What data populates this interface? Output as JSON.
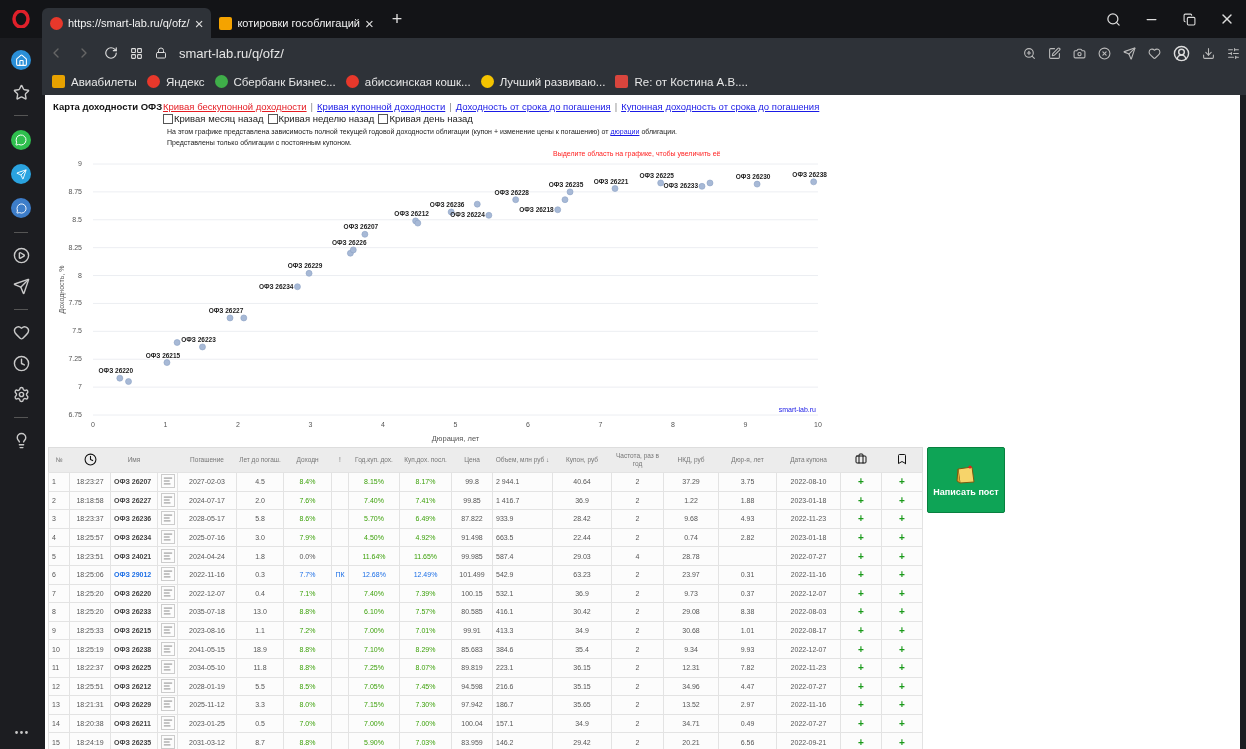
{
  "browser": {
    "tabs": [
      {
        "title": "https://smart-lab.ru/q/ofz/",
        "selected": true,
        "close": "×"
      },
      {
        "title": "котировки гособлигаций",
        "selected": false,
        "close": "×"
      }
    ],
    "new_tab": "+",
    "address": "smart-lab.ru/q/ofz/",
    "bookmarks": [
      {
        "label": "Авиабилеты",
        "color": "#e8a200"
      },
      {
        "label": "Яндекс",
        "color": "#e8382b"
      },
      {
        "label": "Сбербанк Бизнес...",
        "color": "#3fae49"
      },
      {
        "label": "абиссинская кошк...",
        "color": "#e8382b"
      },
      {
        "label": "Лучший развиваю...",
        "color": "#f5c400"
      },
      {
        "label": "Re: от Костина А.В....",
        "color": "#d9453d"
      }
    ]
  },
  "page": {
    "title": "Карта доходности ОФЗ",
    "links": [
      {
        "label": "Кривая бескупонной доходности",
        "selected": true
      },
      {
        "label": "Кривая купонной доходности",
        "selected": false
      },
      {
        "label": "Доходность от срока до погашения",
        "selected": false
      },
      {
        "label": "Купонная доходность от срока до погашения",
        "selected": false
      }
    ],
    "separator": "|",
    "checkboxes": [
      {
        "label": "Кривая месяц назад",
        "checked": false
      },
      {
        "label": "Кривая неделю назад",
        "checked": false
      },
      {
        "label": "Кривая день назад",
        "checked": false
      }
    ],
    "description": [
      {
        "kind": "text",
        "text": "На этом графике представлена зависимость полной текущей годовой доходности облигации (купон + изменение цены к погашению) от "
      },
      {
        "kind": "link",
        "text": "дюрации"
      },
      {
        "kind": "text",
        "text": " облигации."
      }
    ],
    "description_2": "Представлены только облигации с постоянным купоном.",
    "hint": "Выделите область на графике, чтобы увеличить её",
    "credit": "smart-lab.ru",
    "chart_data": {
      "type": "scatter",
      "grid": true,
      "xlabel": "Дюрация, лет",
      "ylabel": "Доходность, %",
      "xlim": [
        0,
        10
      ],
      "ylim": [
        6.75,
        9
      ],
      "xticks": [
        0,
        1,
        2,
        3,
        4,
        5,
        6,
        7,
        8,
        9,
        10
      ],
      "yticks": [
        {
          "value": 6.75,
          "label": "6.75"
        },
        {
          "value": 7,
          "label": "7"
        },
        {
          "value": 7.25,
          "label": "7.25"
        },
        {
          "value": 7.5,
          "label": "7.5"
        },
        {
          "value": 7.75,
          "label": "7.75"
        },
        {
          "value": 8,
          "label": "8"
        },
        {
          "value": 8.25,
          "label": "8.25"
        },
        {
          "value": 8.5,
          "label": "8.5"
        },
        {
          "value": 8.75,
          "label": "8.75"
        },
        {
          "value": 9,
          "label": "9"
        }
      ],
      "x": [
        0.37,
        0.49,
        1.02,
        1.16,
        1.51,
        1.89,
        2.08,
        2.82,
        2.98,
        3.55,
        3.59,
        3.75,
        4.45,
        4.48,
        4.94,
        5.3,
        5.46,
        5.83,
        6.41,
        6.51,
        6.58,
        7.2,
        7.83,
        8.4,
        8.51,
        9.16,
        9.94
      ],
      "series": [
        {
          "color": "#a7b9d6",
          "values": [
            7.08,
            7.05,
            7.22,
            7.4,
            7.36,
            7.62,
            7.62,
            7.9,
            8.02,
            8.2,
            8.23,
            8.37,
            8.49,
            8.47,
            8.57,
            8.64,
            8.54,
            8.68,
            8.59,
            8.68,
            8.75,
            8.78,
            8.83,
            8.8,
            8.83,
            8.82,
            8.84
          ]
        }
      ],
      "annotations": [
        {
          "x": 0.37,
          "y": 7.08,
          "text": "ОФЗ 26220"
        },
        {
          "x": 1.02,
          "y": 7.22,
          "text": "ОФЗ 26215"
        },
        {
          "x": 1.51,
          "y": 7.36,
          "text": "ОФЗ 26223"
        },
        {
          "x": 1.89,
          "y": 7.62,
          "text": "ОФЗ 26227"
        },
        {
          "x": 2.82,
          "y": 7.9,
          "text": "ОФЗ 26234"
        },
        {
          "x": 2.98,
          "y": 8.02,
          "text": "ОФЗ 26229"
        },
        {
          "x": 3.59,
          "y": 8.23,
          "text": "ОФЗ 26226"
        },
        {
          "x": 3.75,
          "y": 8.37,
          "text": "ОФЗ 26207"
        },
        {
          "x": 4.45,
          "y": 8.49,
          "text": "ОФЗ 26212"
        },
        {
          "x": 4.94,
          "y": 8.57,
          "text": "ОФЗ 26236"
        },
        {
          "x": 5.46,
          "y": 8.54,
          "text": "ОФЗ 26224"
        },
        {
          "x": 5.83,
          "y": 8.68,
          "text": "ОФЗ 26228"
        },
        {
          "x": 6.41,
          "y": 8.59,
          "text": "ОФЗ 26218"
        },
        {
          "x": 6.58,
          "y": 8.75,
          "text": "ОФЗ 26235"
        },
        {
          "x": 7.2,
          "y": 8.78,
          "text": "ОФЗ 26221"
        },
        {
          "x": 7.83,
          "y": 8.83,
          "text": "ОФЗ 26225"
        },
        {
          "x": 8.4,
          "y": 8.8,
          "text": "ОФЗ 26233"
        },
        {
          "x": 9.16,
          "y": 8.82,
          "text": "ОФЗ 26230"
        },
        {
          "x": 9.94,
          "y": 8.84,
          "text": "ОФЗ 26238"
        }
      ]
    }
  },
  "table": {
    "columns": [
      {
        "kind": "text",
        "label": "№"
      },
      {
        "kind": "clock"
      },
      {
        "kind": "text",
        "label": "Имя"
      },
      {
        "kind": "blank"
      },
      {
        "kind": "text",
        "label": "Погашение"
      },
      {
        "kind": "text",
        "label": "Лет до погаш."
      },
      {
        "kind": "text",
        "label": "Доходн"
      },
      {
        "kind": "text",
        "label": "!"
      },
      {
        "kind": "text",
        "label": "Год.куп. дох."
      },
      {
        "kind": "text",
        "label": "Куп.дох. посл."
      },
      {
        "kind": "text",
        "label": "Цена"
      },
      {
        "kind": "text",
        "label": "Объем, млн руб ↓"
      },
      {
        "kind": "text",
        "label": "Купон, руб"
      },
      {
        "kind": "text",
        "label": "Частота, раз в год"
      },
      {
        "kind": "text",
        "label": "НКД, руб"
      },
      {
        "kind": "text",
        "label": "Дюр-я, лет"
      },
      {
        "kind": "text",
        "label": "Дата купона"
      },
      {
        "kind": "briefcase"
      },
      {
        "kind": "bookmark"
      }
    ],
    "rows": [
      {
        "n": "1",
        "time": "18:23:27",
        "name": "ОФЗ 26207",
        "highlighted": false,
        "maturity": "2027-02-03",
        "years": "4.5",
        "yield": "8.4%",
        "yield_muted": false,
        "coupon_yield": "8.15%",
        "last_coupon_yield": "8.17%",
        "price": "99.8",
        "volume": "2 944.1",
        "coupon": "40.64",
        "frequency": "2",
        "accrued": "37.29",
        "duration": "3.75",
        "coupon_date": "2022-08-10",
        "actions": [
          "+",
          "+"
        ]
      },
      {
        "n": "2",
        "time": "18:18:58",
        "name": "ОФЗ 26227",
        "highlighted": false,
        "maturity": "2024-07-17",
        "years": "2.0",
        "yield": "7.6%",
        "yield_muted": false,
        "coupon_yield": "7.40%",
        "last_coupon_yield": "7.41%",
        "price": "99.85",
        "volume": "1 416.7",
        "coupon": "36.9",
        "frequency": "2",
        "accrued": "1.22",
        "duration": "1.88",
        "coupon_date": "2023-01-18",
        "actions": [
          "+",
          "+"
        ]
      },
      {
        "n": "3",
        "time": "18:23:37",
        "name": "ОФЗ 26236",
        "highlighted": false,
        "maturity": "2028-05-17",
        "years": "5.8",
        "yield": "8.6%",
        "yield_muted": false,
        "coupon_yield": "5.70%",
        "last_coupon_yield": "6.49%",
        "price": "87.822",
        "volume": "933.9",
        "coupon": "28.42",
        "frequency": "2",
        "accrued": "9.68",
        "duration": "4.93",
        "coupon_date": "2022-11-23",
        "actions": [
          "+",
          "+"
        ]
      },
      {
        "n": "4",
        "time": "18:25:57",
        "name": "ОФЗ 26234",
        "highlighted": false,
        "maturity": "2025-07-16",
        "years": "3.0",
        "yield": "7.9%",
        "yield_muted": false,
        "coupon_yield": "4.50%",
        "last_coupon_yield": "4.92%",
        "price": "91.498",
        "volume": "663.5",
        "coupon": "22.44",
        "frequency": "2",
        "accrued": "0.74",
        "duration": "2.82",
        "coupon_date": "2023-01-18",
        "actions": [
          "+",
          "+"
        ]
      },
      {
        "n": "5",
        "time": "18:23:51",
        "name": "ОФЗ 24021",
        "highlighted": false,
        "maturity": "2024-04-24",
        "years": "1.8",
        "yield": "0.0%",
        "yield_muted": true,
        "coupon_yield": "11.64%",
        "last_coupon_yield": "11.65%",
        "price": "99.985",
        "volume": "587.4",
        "coupon": "29.03",
        "frequency": "4",
        "accrued": "28.78",
        "coupon_date": "2022-07-27",
        "actions": [
          "+",
          "+"
        ]
      },
      {
        "n": "6",
        "time": "18:25:06",
        "name": "ОФЗ 29012",
        "highlighted": true,
        "maturity": "2022-11-16",
        "years": "0.3",
        "yield": "7.7%",
        "yield_muted": false,
        "flag": "ПК",
        "coupon_yield": "12.68%",
        "last_coupon_yield": "12.49%",
        "price": "101.499",
        "volume": "542.9",
        "coupon": "63.23",
        "frequency": "2",
        "accrued": "23.97",
        "duration": "0.31",
        "coupon_date": "2022-11-16",
        "actions": [
          "+",
          "+"
        ]
      },
      {
        "n": "7",
        "time": "18:25:20",
        "name": "ОФЗ 26220",
        "highlighted": false,
        "maturity": "2022-12-07",
        "years": "0.4",
        "yield": "7.1%",
        "yield_muted": false,
        "coupon_yield": "7.40%",
        "last_coupon_yield": "7.39%",
        "price": "100.15",
        "volume": "532.1",
        "coupon": "36.9",
        "frequency": "2",
        "accrued": "9.73",
        "duration": "0.37",
        "coupon_date": "2022-12-07",
        "actions": [
          "+",
          "+"
        ]
      },
      {
        "n": "8",
        "time": "18:25:20",
        "name": "ОФЗ 26233",
        "highlighted": false,
        "maturity": "2035-07-18",
        "years": "13.0",
        "yield": "8.8%",
        "yield_muted": false,
        "coupon_yield": "6.10%",
        "last_coupon_yield": "7.57%",
        "price": "80.585",
        "volume": "416.1",
        "coupon": "30.42",
        "frequency": "2",
        "accrued": "29.08",
        "duration": "8.38",
        "coupon_date": "2022-08-03",
        "actions": [
          "+",
          "+"
        ]
      },
      {
        "n": "9",
        "time": "18:25:33",
        "name": "ОФЗ 26215",
        "highlighted": false,
        "maturity": "2023-08-16",
        "years": "1.1",
        "yield": "7.2%",
        "yield_muted": false,
        "coupon_yield": "7.00%",
        "last_coupon_yield": "7.01%",
        "price": "99.91",
        "volume": "413.3",
        "coupon": "34.9",
        "frequency": "2",
        "accrued": "30.68",
        "duration": "1.01",
        "coupon_date": "2022-08-17",
        "actions": [
          "+",
          "+"
        ]
      },
      {
        "n": "10",
        "time": "18:25:19",
        "name": "ОФЗ 26238",
        "highlighted": false,
        "maturity": "2041-05-15",
        "years": "18.9",
        "yield": "8.8%",
        "yield_muted": false,
        "coupon_yield": "7.10%",
        "last_coupon_yield": "8.29%",
        "price": "85.683",
        "volume": "384.6",
        "coupon": "35.4",
        "frequency": "2",
        "accrued": "9.34",
        "duration": "9.93",
        "coupon_date": "2022-12-07",
        "actions": [
          "+",
          "+"
        ]
      },
      {
        "n": "11",
        "time": "18:22:37",
        "name": "ОФЗ 26225",
        "highlighted": false,
        "maturity": "2034-05-10",
        "years": "11.8",
        "yield": "8.8%",
        "yield_muted": false,
        "coupon_yield": "7.25%",
        "last_coupon_yield": "8.07%",
        "price": "89.819",
        "volume": "223.1",
        "coupon": "36.15",
        "frequency": "2",
        "accrued": "12.31",
        "duration": "7.82",
        "coupon_date": "2022-11-23",
        "actions": [
          "+",
          "+"
        ]
      },
      {
        "n": "12",
        "time": "18:25:51",
        "name": "ОФЗ 26212",
        "highlighted": false,
        "maturity": "2028-01-19",
        "years": "5.5",
        "yield": "8.5%",
        "yield_muted": false,
        "coupon_yield": "7.05%",
        "last_coupon_yield": "7.45%",
        "price": "94.598",
        "volume": "216.6",
        "coupon": "35.15",
        "frequency": "2",
        "accrued": "34.96",
        "duration": "4.47",
        "coupon_date": "2022-07-27",
        "actions": [
          "+",
          "+"
        ]
      },
      {
        "n": "13",
        "time": "18:21:31",
        "name": "ОФЗ 26229",
        "highlighted": false,
        "maturity": "2025-11-12",
        "years": "3.3",
        "yield": "8.0%",
        "yield_muted": false,
        "coupon_yield": "7.15%",
        "last_coupon_yield": "7.30%",
        "price": "97.942",
        "volume": "186.7",
        "coupon": "35.65",
        "frequency": "2",
        "accrued": "13.52",
        "duration": "2.97",
        "coupon_date": "2022-11-16",
        "actions": [
          "+",
          "+"
        ]
      },
      {
        "n": "14",
        "time": "18:20:38",
        "name": "ОФЗ 26211",
        "highlighted": false,
        "maturity": "2023-01-25",
        "years": "0.5",
        "yield": "7.0%",
        "yield_muted": false,
        "coupon_yield": "7.00%",
        "last_coupon_yield": "7.00%",
        "price": "100.04",
        "volume": "157.1",
        "coupon": "34.9",
        "frequency": "2",
        "accrued": "34.71",
        "duration": "0.49",
        "coupon_date": "2022-07-27",
        "actions": [
          "+",
          "+"
        ]
      },
      {
        "n": "15",
        "time": "18:24:19",
        "name": "ОФЗ 26235",
        "highlighted": false,
        "maturity": "2031-03-12",
        "years": "8.7",
        "yield": "8.8%",
        "yield_muted": false,
        "coupon_yield": "5.90%",
        "last_coupon_yield": "7.03%",
        "price": "83.959",
        "volume": "146.2",
        "coupon": "29.42",
        "frequency": "2",
        "accrued": "20.21",
        "duration": "6.56",
        "coupon_date": "2022-09-21",
        "actions": [
          "+",
          "+"
        ]
      }
    ]
  },
  "post_button": {
    "label": "Написать пост"
  }
}
